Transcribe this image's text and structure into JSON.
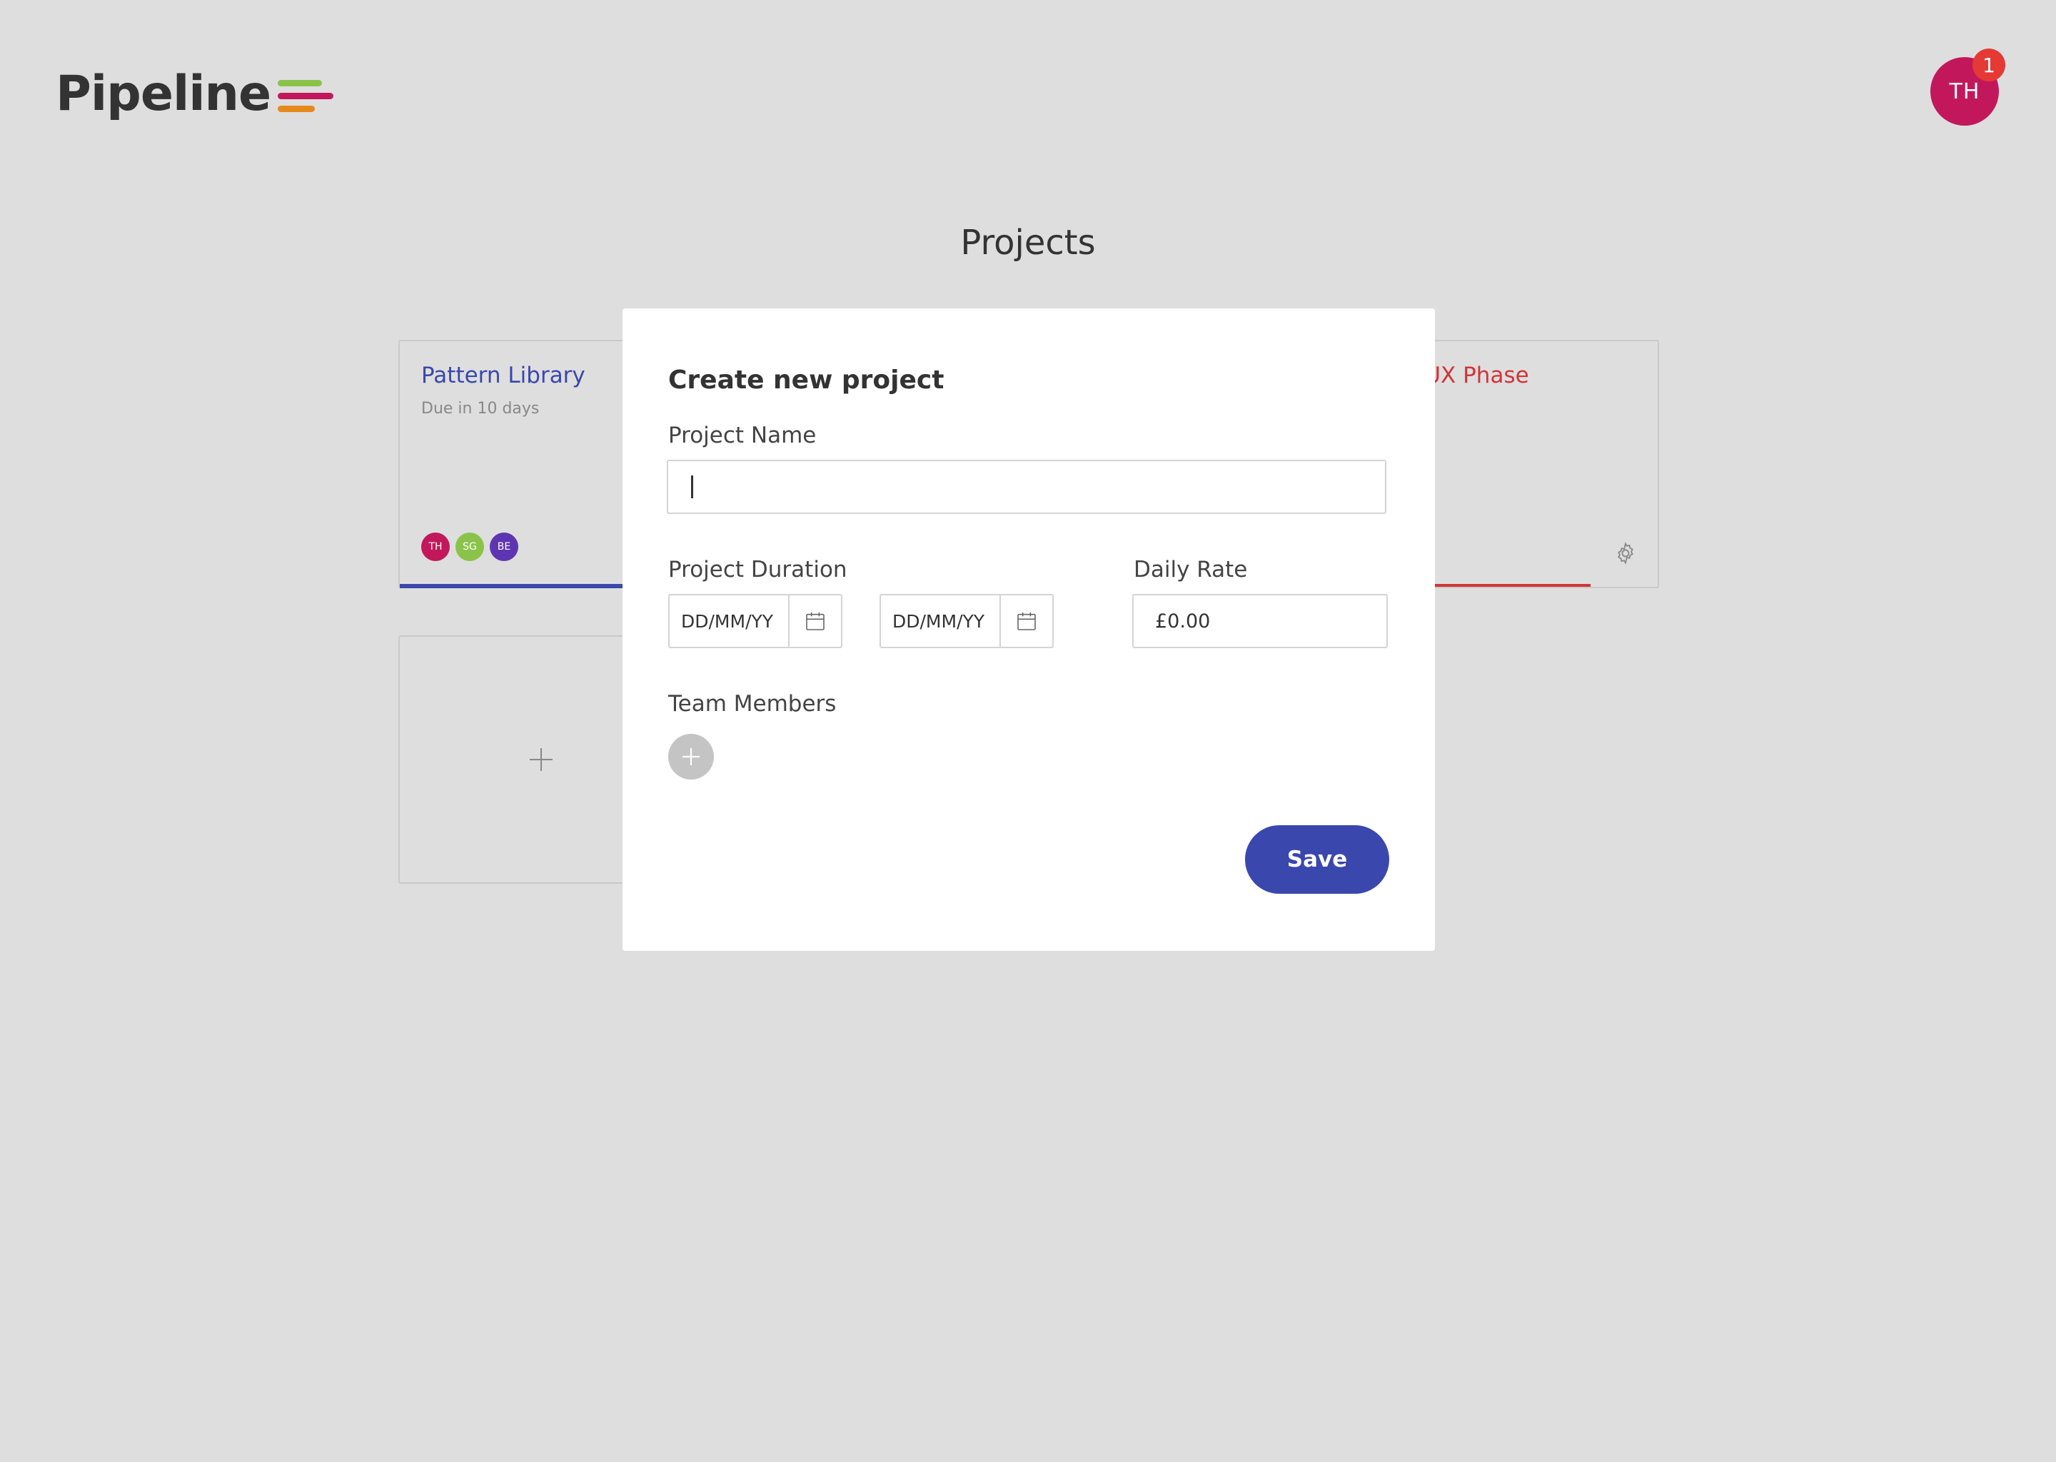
{
  "colors": {
    "background": "#dedede",
    "primary": "#3a47ad",
    "accent_red": "#d13438",
    "avatar_th": "#c2185b",
    "avatar_sg": "#8bc34a",
    "avatar_be": "#5e35b1",
    "badge": "#e53935",
    "logo_green": "#8bc34a",
    "logo_pink": "#c2185b",
    "logo_orange": "#e6891c"
  },
  "header": {
    "logo_text": "Pipeline",
    "user_initials": "TH",
    "notification_count": "1"
  },
  "page": {
    "title": "Projects"
  },
  "projects": [
    {
      "title": "Pattern Library",
      "due": "Due in 10 days",
      "team": [
        "TH",
        "SG",
        "BE"
      ]
    },
    {
      "title": "ght UX Phase"
    }
  ],
  "modal": {
    "title": "Create new project",
    "project_name_label": "Project Name",
    "project_name_value": "",
    "duration_label": "Project Duration",
    "start_date_placeholder": "DD/MM/YY",
    "end_date_placeholder": "DD/MM/YY",
    "daily_rate_label": "Daily Rate",
    "daily_rate_value": "£0.00",
    "team_members_label": "Team Members",
    "save_label": "Save"
  },
  "icons": {
    "calendar": "calendar-icon",
    "plus": "plus-icon",
    "gear": "gear-icon"
  }
}
